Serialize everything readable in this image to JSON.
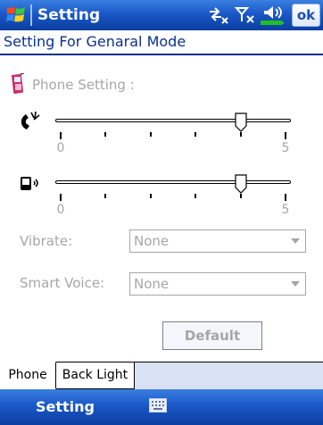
{
  "titlebar": {
    "app_title": "Setting",
    "ok_label": "ok",
    "icons": [
      "windows-start-icon",
      "connectivity-icon",
      "signal-off-icon",
      "volume-icon",
      "battery-icon"
    ]
  },
  "header": {
    "title": "Setting For Genaral Mode"
  },
  "section": {
    "icon": "phone-icon",
    "label": "Phone Setting :"
  },
  "ring_volume": {
    "icon": "ringer-icon",
    "value": 4,
    "min": 0,
    "max": 5,
    "min_label": "0",
    "max_label": "5"
  },
  "system_volume": {
    "icon": "device-volume-icon",
    "value": 4,
    "min": 0,
    "max": 5,
    "min_label": "0",
    "max_label": "5"
  },
  "vibrate": {
    "label": "Vibrate:",
    "value": "None"
  },
  "smart_voice": {
    "label": "Smart Voice:",
    "value": "None"
  },
  "default_label": "Default",
  "tabs": [
    {
      "label": "Phone",
      "active": true
    },
    {
      "label": "Back Light",
      "active": false
    }
  ],
  "bottombar": {
    "softkey_label": "Setting",
    "keyboard_icon": "keyboard-icon"
  },
  "colors": {
    "titlebar": "#1a58c8",
    "header_text": "#0c2f8f",
    "disabled_text": "#a6a6a6",
    "tab_strip": "#d8e2f2"
  }
}
